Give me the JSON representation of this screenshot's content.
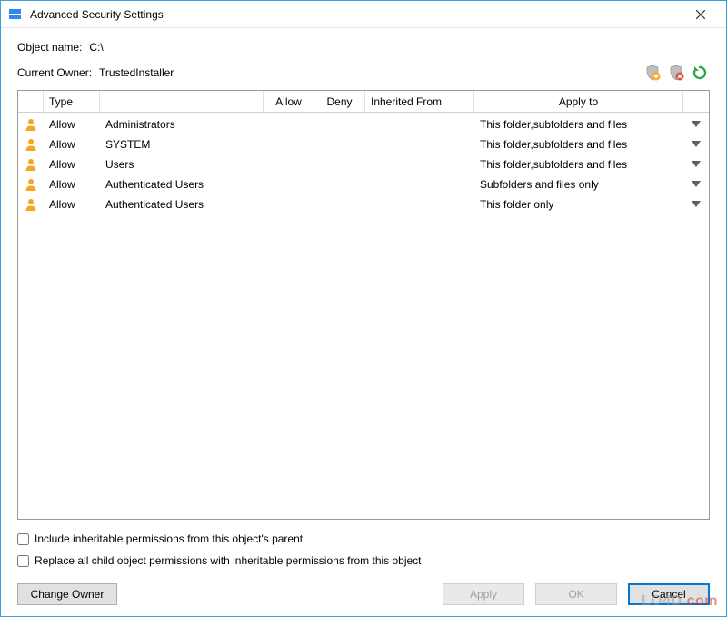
{
  "window": {
    "title": "Advanced Security Settings"
  },
  "object": {
    "label": "Object name:",
    "value": "C:\\"
  },
  "owner": {
    "label": "Current Owner:",
    "value": "TrustedInstaller"
  },
  "columns": {
    "type": "Type",
    "name": "",
    "allow": "Allow",
    "deny": "Deny",
    "inherited": "Inherited From",
    "apply": "Apply to"
  },
  "entries": [
    {
      "type": "Allow",
      "principal": "Administrators",
      "allow": "",
      "deny": "",
      "inherited": "",
      "apply": "This folder,subfolders and files"
    },
    {
      "type": "Allow",
      "principal": "SYSTEM",
      "allow": "",
      "deny": "",
      "inherited": "",
      "apply": "This folder,subfolders and files"
    },
    {
      "type": "Allow",
      "principal": "Users",
      "allow": "",
      "deny": "",
      "inherited": "",
      "apply": "This folder,subfolders and files"
    },
    {
      "type": "Allow",
      "principal": "Authenticated Users",
      "allow": "",
      "deny": "",
      "inherited": "",
      "apply": "Subfolders and files only"
    },
    {
      "type": "Allow",
      "principal": "Authenticated Users",
      "allow": "",
      "deny": "",
      "inherited": "",
      "apply": "This folder only"
    }
  ],
  "checkboxes": {
    "inherit": "Include inheritable permissions from this object's parent",
    "replace": "Replace all child object permissions with inheritable permissions from this object"
  },
  "buttons": {
    "changeOwner": "Change Owner",
    "apply": "Apply",
    "ok": "OK",
    "cancel": "Cancel"
  },
  "watermark": {
    "text1": "LO4D",
    "text2": ".com"
  }
}
